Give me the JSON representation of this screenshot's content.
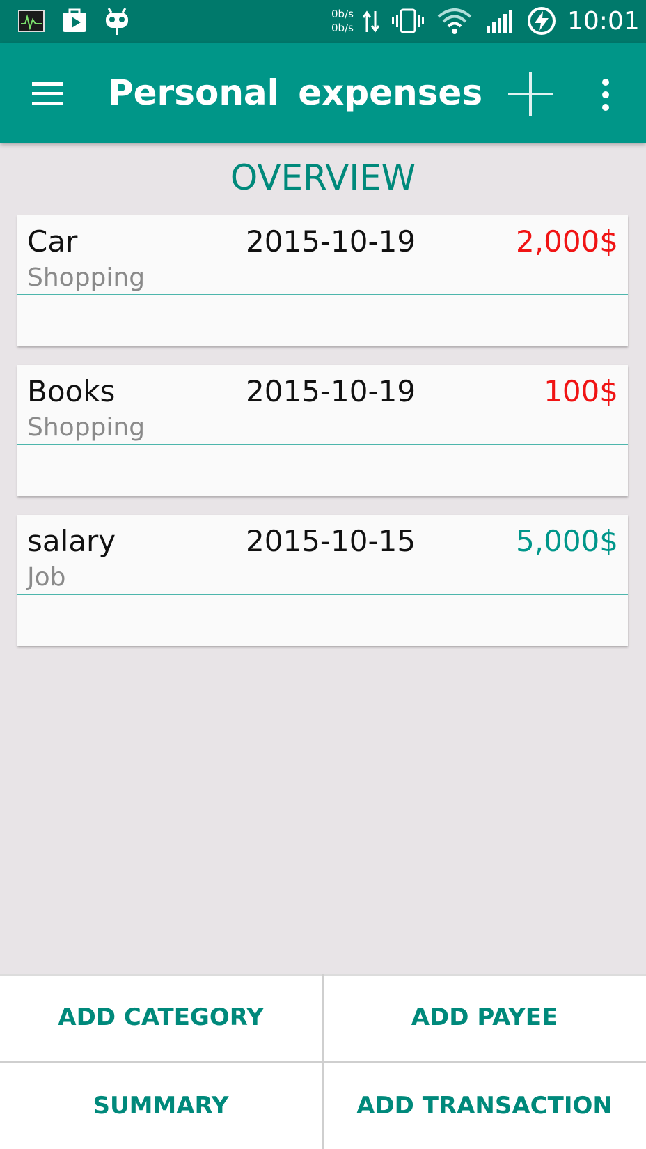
{
  "status_bar": {
    "icons_left": [
      "activity-monitor-icon",
      "play-store-icon",
      "cyanogen-mascot-icon"
    ],
    "speed_up": "0b/s",
    "speed_down": "0b/s",
    "icons_right": [
      "data-transfer-icon",
      "vibrate-icon",
      "wifi-icon",
      "signal-icon",
      "battery-charging-icon"
    ],
    "time": "10:01"
  },
  "app_bar": {
    "title": "Personal expenses",
    "menu_icon": "hamburger-menu-icon",
    "add_icon": "plus-icon",
    "more_icon": "more-vert-icon"
  },
  "colors": {
    "primary": "#009688",
    "primary_dark": "#00796b",
    "expense": "#f01414",
    "income": "#00968a"
  },
  "overview": {
    "heading": "OVERVIEW"
  },
  "transactions": [
    {
      "name": "Car",
      "date": "2015-10-19",
      "amount": "2,000$",
      "category": "Shopping",
      "type": "expense"
    },
    {
      "name": "Books",
      "date": "2015-10-19",
      "amount": "100$",
      "category": "Shopping",
      "type": "expense"
    },
    {
      "name": "salary",
      "date": "2015-10-15",
      "amount": "5,000$",
      "category": "Job",
      "type": "income"
    }
  ],
  "bottom_actions": {
    "add_category": "ADD CATEGORY",
    "add_payee": "ADD PAYEE",
    "summary": "SUMMARY",
    "add_transaction": "ADD TRANSACTION"
  }
}
